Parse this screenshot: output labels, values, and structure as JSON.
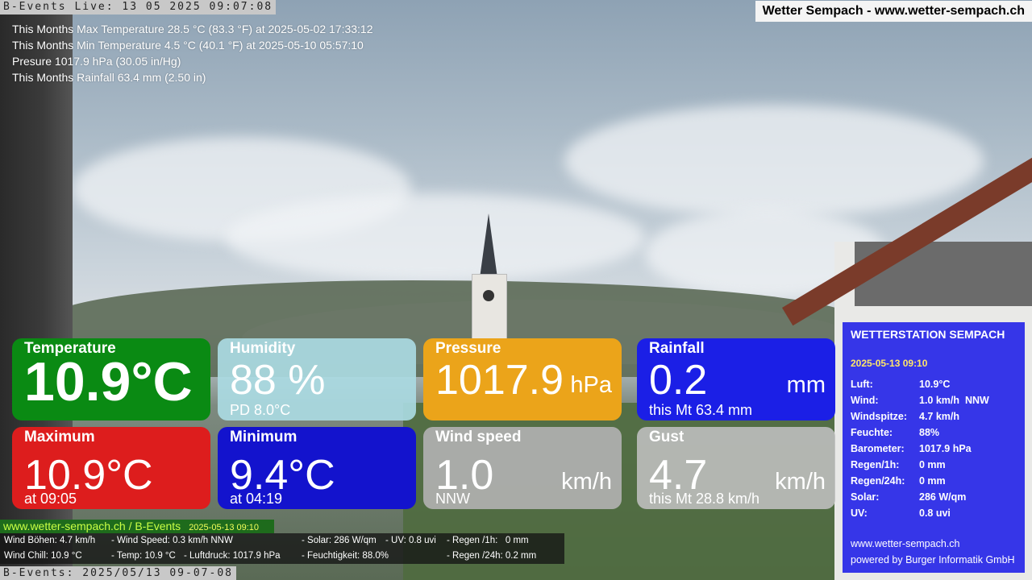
{
  "ticker_top": "B-Events Live: 13 05 2025 09:07:08",
  "site_title": "Wetter Sempach - www.wetter-sempach.ch",
  "stats": [
    "This Months Max Temperature 28.5 °C (83.3 °F) at 2025-05-02 17:33:12",
    "This Months Min Temperature 4.5 °C (40.1 °F) at 2025-05-10 05:57:10",
    "Presure 1017.9 hPa (30.05 in/Hg)",
    "This Months Rainfall 63.4 mm (2.50 in)"
  ],
  "tiles": {
    "temperature": {
      "label": "Temperature",
      "value": "10.9°C"
    },
    "humidity": {
      "label": "Humidity",
      "value": "88 %",
      "sub": "PD 8.0°C"
    },
    "pressure": {
      "label": "Pressure",
      "value": "1017.9",
      "unit": "hPa"
    },
    "rainfall": {
      "label": "Rainfall",
      "value": "0.2",
      "unit": "mm",
      "sub": "this Mt 63.4 mm"
    },
    "maximum": {
      "label": "Maximum",
      "value": "10.9°C",
      "sub": "at 09:05"
    },
    "minimum": {
      "label": "Minimum",
      "value": "9.4°C",
      "sub": "at 04:19"
    },
    "wind_speed": {
      "label": "Wind speed",
      "value": "1.0",
      "unit": "km/h",
      "sub": "NNW"
    },
    "gust": {
      "label": "Gust",
      "value": "4.7",
      "unit": "km/h",
      "sub": "this Mt 28.8 km/h"
    }
  },
  "station": {
    "title": "WETTERSTATION SEMPACH",
    "date": "2025-05-13 09:10",
    "rows": [
      {
        "key": "Luft:",
        "value": "10.9°C"
      },
      {
        "key": "Wind:",
        "value": "1.0 km/h  NNW"
      },
      {
        "key": "Windspitze:",
        "value": "4.7 km/h"
      },
      {
        "key": "Feuchte:",
        "value": "88%"
      },
      {
        "key": "Barometer:",
        "value": "1017.9 hPa"
      },
      {
        "key": "Regen/1h:",
        "value": "0 mm"
      },
      {
        "key": "Regen/24h:",
        "value": "0 mm"
      },
      {
        "key": "Solar:",
        "value": "286 W/qm"
      },
      {
        "key": "UV:",
        "value": "0.8 uvi"
      }
    ],
    "site": "www.wetter-sempach.ch",
    "powered": "powered by Burger Informatik GmbH"
  },
  "bottom_bar": {
    "site": "www.wetter-sempach.ch / B-Events",
    "time": "2025-05-13 09:10"
  },
  "data_lines": {
    "l1a": "Wind Böhen: 4.7 km/h",
    "l1b": "- Wind Speed: 0.3 km/h NNW",
    "l1c": "- Solar: 286 W/qm",
    "l1d": "- UV: 0.8 uvi",
    "l1e": "- Regen /1h:   0 mm",
    "l2a": "Wind Chill: 10.9 °C",
    "l2b": "- Temp: 10.9 °C",
    "l2c": "- Luftdruck: 1017.9 hPa",
    "l2d": "- Feuchtigkeit: 88.0%",
    "l2e": "- Regen /24h: 0.2 mm"
  },
  "ticker_bottom": "B-Events: 2025/05/13 09-07-08"
}
